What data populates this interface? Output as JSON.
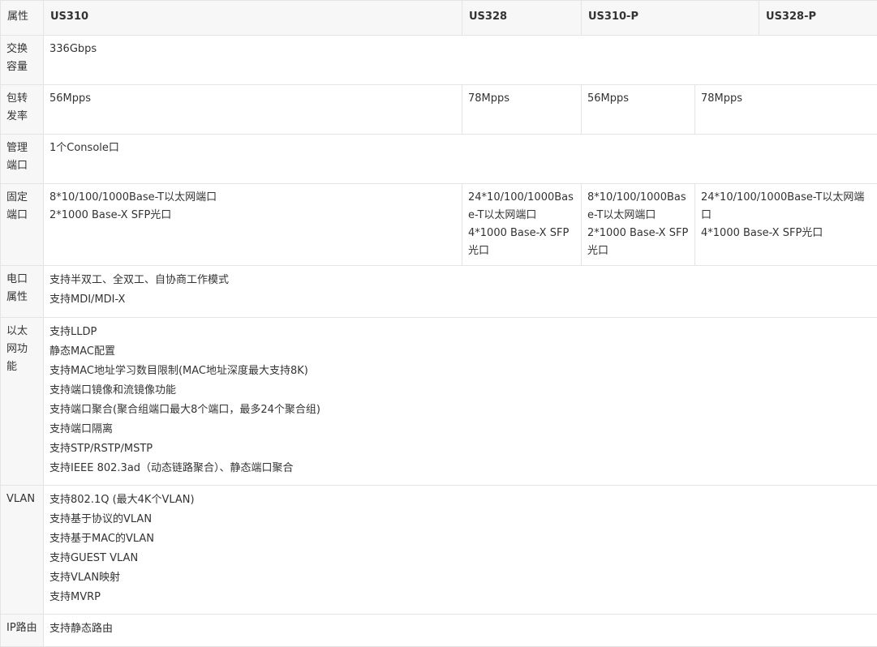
{
  "header": {
    "attr": "属性",
    "col1": "US310",
    "col2": "US328",
    "col3": "US310-P",
    "col4": "US328-P"
  },
  "rows": {
    "capacity": {
      "label": [
        "交换",
        "容量"
      ],
      "value": "336Gbps"
    },
    "pps": {
      "label": [
        "包转",
        "发率"
      ],
      "values": [
        "56Mpps",
        "78Mpps",
        "56Mpps",
        "78Mpps"
      ]
    },
    "mgmt": {
      "label": [
        "管理",
        "端口"
      ],
      "value": "1个Console口"
    },
    "fixed": {
      "label": [
        "固定",
        "端口"
      ],
      "c1": [
        "8*10/100/1000Base-T以太网端口",
        "2*1000 Base-X SFP光口"
      ],
      "c2": [
        "24*10/100/1000Base-T以太网端口",
        "4*1000 Base-X SFP光口"
      ],
      "c3": [
        "8*10/100/1000Base-T以太网端口",
        "2*1000 Base-X SFP光口"
      ],
      "c4": [
        "24*10/100/1000Base-T以太网端口",
        "4*1000 Base-X SFP光口"
      ]
    },
    "electrical": {
      "label": [
        "电口",
        "属性"
      ],
      "items": [
        "支持半双工、全双工、自协商工作模式",
        "支持MDI/MDI-X"
      ]
    },
    "ethernet": {
      "label": [
        "以太",
        "网功",
        "能"
      ],
      "items": [
        "支持LLDP",
        "静态MAC配置",
        "支持MAC地址学习数目限制(MAC地址深度最大支持8K)",
        "支持端口镜像和流镜像功能",
        "支持端口聚合(聚合组端口最大8个端口，最多24个聚合组)",
        "支持端口隔离",
        "支持STP/RSTP/MSTP",
        "支持IEEE 802.3ad（动态链路聚合）、静态端口聚合"
      ]
    },
    "vlan": {
      "label": [
        "VLAN"
      ],
      "items": [
        "支持802.1Q (最大4K个VLAN)",
        "支持基于协议的VLAN",
        "支持基于MAC的VLAN",
        "支持GUEST VLAN",
        "支持VLAN映射",
        "支持MVRP"
      ]
    },
    "routing": {
      "label": [
        "IP路由"
      ],
      "items": [
        "支持静态路由"
      ]
    }
  }
}
